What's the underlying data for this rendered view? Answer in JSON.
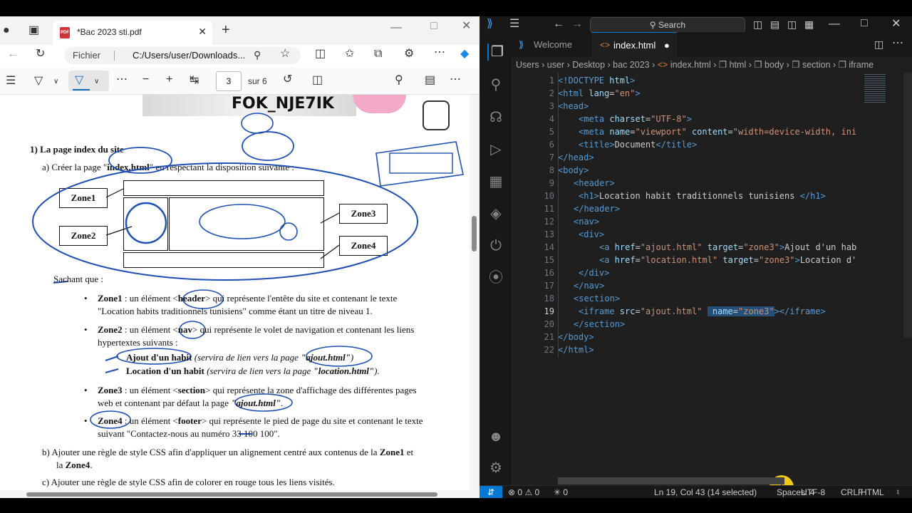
{
  "edge": {
    "tab_title": "*Bac 2023 sti.pdf",
    "address_label": "Fichier",
    "address_url": "C:/Users/user/Downloads...",
    "page_current": "3",
    "page_total": "sur 6",
    "icons": [
      "profile-icon",
      "tab-actions-icon",
      "pdf-file-icon",
      "close-tab-icon",
      "new-tab-icon",
      "back-icon",
      "refresh-icon",
      "zoom-icon",
      "favorite-icon",
      "split-screen-icon",
      "favorites-icon",
      "collections-icon",
      "extensions-icon",
      "more-icon",
      "copilot-icon",
      "contents-icon",
      "highlight-icon",
      "draw-icon",
      "erase-icon",
      "zoom-out-icon",
      "zoom-in-icon",
      "fit-page-icon",
      "rotate-icon",
      "page-view-icon",
      "find-icon",
      "save-icon",
      "menu-icon"
    ]
  },
  "pdf": {
    "header_text": "FOK_NJE7IK",
    "q1_title": "1) La page index du site",
    "q1a_prefix": "a)  Créer la page \"",
    "q1a_file": "index.html",
    "q1a_suffix": "\" en respectant la disposition suivante :",
    "zones": [
      "Zone1",
      "Zone2",
      "Zone3",
      "Zone4"
    ],
    "sachant": "Sachant que :",
    "z1_label": "Zone1",
    "z1_a": " : un élément <",
    "z1_tag": "header",
    "z1_b": "> qui représente l'entête du site et contenant le texte",
    "z1_line2": "\"Location habits traditionnels tunisiens\" comme étant un titre de niveau 1.",
    "z2_label": "Zone2",
    "z2_a": " : un élément <",
    "z2_tag": "nav",
    "z2_b": "> qui représente le volet de navigation et contenant les liens",
    "z2_line2": "hypertextes suivants :",
    "link1": "Ajout d'un habit",
    "link1_note_a": " (servira de lien vers la page ",
    "link1_note_b": "\"ajout.html\"",
    "link1_note_c": ")",
    "link2": "Location d'un habit",
    "link2_note_a": " (servira de lien vers la page ",
    "link2_note_b": "\"location.html\"",
    "link2_note_c": ").",
    "z3_label": "Zone3",
    "z3_a": " : un élément <",
    "z3_tag": "section",
    "z3_b": "> qui représente la zone d'affichage des différentes pages",
    "z3_line2a": "web et contenant par défaut la page ",
    "z3_line2b": "\"ajout.html\"",
    "z3_line2c": ".",
    "z4_label": "Zone4",
    "z4_a": " : un élément <",
    "z4_tag": "footer",
    "z4_b": "> qui représente le pied de page du site et contenant le texte",
    "z4_line2": "suivant \"Contactez-nous au numéro 33 100 100\".",
    "qb_a": "b)  Ajouter une règle de style CSS afin d'appliquer un alignement centré aux contenus de la ",
    "qb_z1": "Zone1",
    "qb_b": " et",
    "qb_line2a": "la ",
    "qb_line2b": "Zone4",
    "qb_line2c": ".",
    "qc": "c)  Ajouter une règle de style CSS afin de colorer en rouge tous les liens visités."
  },
  "vscode": {
    "search": "Search",
    "tabs": [
      {
        "label": "Welcome"
      },
      {
        "label": "index.html"
      }
    ],
    "breadcrumbs": [
      "Users",
      "user",
      "Desktop",
      "bac 2023",
      "index.html",
      "html",
      "body",
      "section",
      "iframe"
    ],
    "line_numbers": [
      "1",
      "2",
      "3",
      "4",
      "5",
      "6",
      "7",
      "8",
      "9",
      "10",
      "11",
      "12",
      "13",
      "14",
      "15",
      "16",
      "17",
      "18",
      "19",
      "20",
      "21",
      "22"
    ],
    "current_line": "19",
    "code": {
      "l1_tag": "<!DOCTYPE",
      "l1_val": " html",
      "l1_end": ">",
      "l2_open": "<html",
      "l2_attr": " lang",
      "l2_val": "\"en\"",
      "l3": "<head>",
      "l4_open": "<meta",
      "l4_attr": " charset",
      "l4_val": "\"UTF-8\"",
      "l5_open": "<meta",
      "l5_attr1": " name",
      "l5_val1": "\"viewport\"",
      "l5_attr2": " content",
      "l5_val2": "\"width=device-width, ini",
      "l6_open": "<title>",
      "l6_text": "Document",
      "l6_close": "</title>",
      "l7": "</head>",
      "l8": "<body>",
      "l9": "<header>",
      "l10_open": "<h1>",
      "l10_text": "Location habit traditionnels tunisiens ",
      "l10_close": "</h1>",
      "l11": "</header>",
      "l12": "<nav>",
      "l13": "<div>",
      "l14_open": "<a",
      "l14_attr1": " href",
      "l14_val1": "\"ajout.html\"",
      "l14_attr2": " target",
      "l14_val2": "\"zone3\"",
      "l14_text": "Ajout d'un habi",
      "l15_open": "<a",
      "l15_attr1": " href",
      "l15_val1": "\"location.html\"",
      "l15_attr2": " target",
      "l15_val2": "\"zone3\"",
      "l15_text": "Location d'u",
      "l16": "</div>",
      "l17": "</nav>",
      "l18": "<section>",
      "l19_open": "<iframe",
      "l19_attr1": " src",
      "l19_val1": "\"ajout.html\"",
      "l19_attr2": " name",
      "l19_val2": "\"zone3\"",
      "l19_close": "</iframe>",
      "l20": "</section>",
      "l21": "</body>",
      "l22": "</html>",
      "eq": "=",
      "gt": ">"
    },
    "status": {
      "errors": "0",
      "warnings": "0",
      "ports": "0",
      "position": "Ln 19, Col 43 (14 selected)",
      "spaces": "Spaces: 4",
      "encoding": "UTF-8",
      "eol": "CRLF",
      "language": "HTML"
    },
    "colors": {
      "accent": "#0078d4",
      "tag": "#569cd6",
      "attr": "#9cdcfe",
      "string": "#ce9178",
      "selection": "#264f78"
    }
  }
}
